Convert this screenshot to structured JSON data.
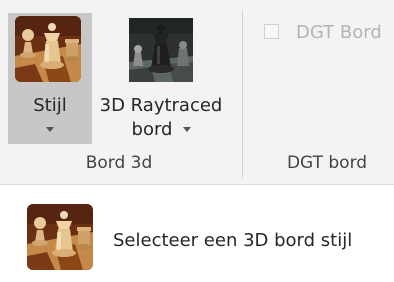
{
  "ribbon": {
    "buttons": [
      {
        "id": "stijl",
        "label": "Stijl",
        "icon": "chess-board-icon",
        "selected": true,
        "has_dropdown": true
      },
      {
        "id": "raytraced",
        "label_line1": "3D Raytraced",
        "label_line2": "bord",
        "icon": "raytraced-chess-icon",
        "has_dropdown": true
      }
    ],
    "groups": [
      {
        "label": "Bord 3d"
      },
      {
        "label": "DGT bord"
      }
    ],
    "dgt_checkbox": {
      "label": "DGT Bord",
      "checked": false,
      "enabled": false
    }
  },
  "tooltip": {
    "icon": "chess-board-icon",
    "text": "Selecteer een 3D bord stijl"
  },
  "colors": {
    "ribbon_background": "#f3f3f3",
    "selected_button": "#c7c7c7",
    "disabled_text": "#b4b4b4"
  }
}
